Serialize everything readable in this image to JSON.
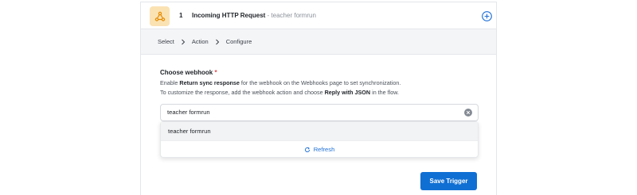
{
  "step": {
    "number": "1",
    "title": "Incoming HTTP Request",
    "subtitle": "- teacher formrun",
    "icon": "webhook-icon",
    "icon_bg": "#fbe2b3"
  },
  "breadcrumb": {
    "items": [
      "Select",
      "Action",
      "Configure"
    ]
  },
  "webhook_field": {
    "label": "Choose webhook",
    "required_mark": "*",
    "help_line1_pre": "Enable ",
    "help_line1_bold": "Return sync response",
    "help_line1_post": " for the webhook on the Webhooks page to set synchronization.",
    "help_line2_pre": "To customize the response, add the webhook action and choose ",
    "help_line2_bold": "Reply with JSON",
    "help_line2_post": " in the flow.",
    "value": "teacher formrun"
  },
  "dropdown": {
    "options": [
      "teacher formrun"
    ],
    "refresh_label": "Refresh"
  },
  "actions": {
    "save_label": "Save Trigger"
  },
  "colors": {
    "primary": "#0f6fd3",
    "required": "#e5484d",
    "link": "#1d6fd6"
  }
}
